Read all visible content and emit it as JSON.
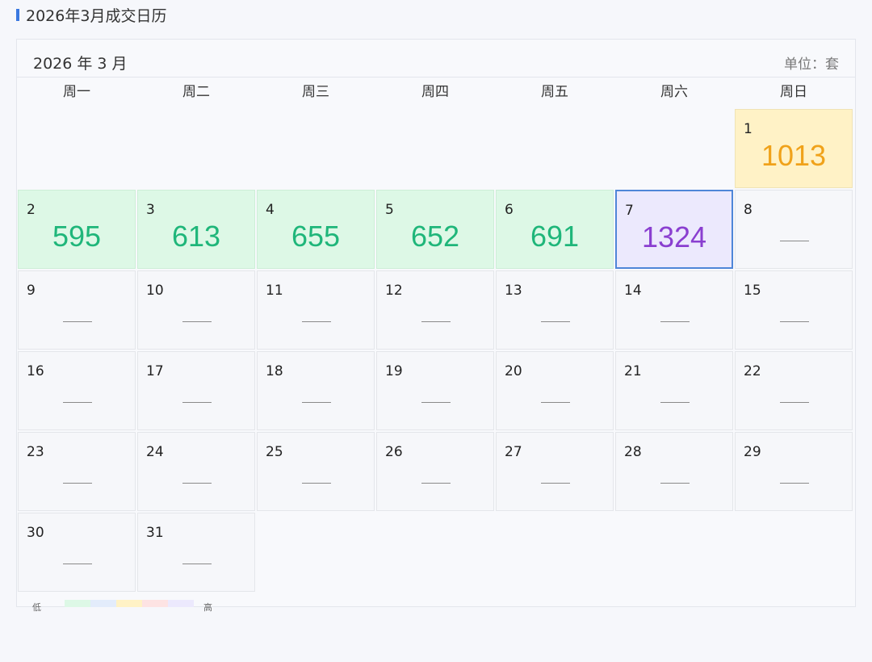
{
  "title": "2026年3月成交日历",
  "calendar": {
    "month_label": "2026 年 3 月",
    "unit_label": "单位：套",
    "weekdays": [
      "周一",
      "周二",
      "周三",
      "周四",
      "周五",
      "周六",
      "周日"
    ],
    "days": [
      {
        "day": "1",
        "value": "1013",
        "level": "yellow"
      },
      {
        "day": "2",
        "value": "595",
        "level": "green"
      },
      {
        "day": "3",
        "value": "613",
        "level": "green"
      },
      {
        "day": "4",
        "value": "655",
        "level": "green"
      },
      {
        "day": "5",
        "value": "652",
        "level": "green"
      },
      {
        "day": "6",
        "value": "691",
        "level": "green"
      },
      {
        "day": "7",
        "value": "1324",
        "level": "purple",
        "selected": true
      },
      {
        "day": "8",
        "value": null
      },
      {
        "day": "9",
        "value": null
      },
      {
        "day": "10",
        "value": null
      },
      {
        "day": "11",
        "value": null
      },
      {
        "day": "12",
        "value": null
      },
      {
        "day": "13",
        "value": null
      },
      {
        "day": "14",
        "value": null
      },
      {
        "day": "15",
        "value": null
      },
      {
        "day": "16",
        "value": null
      },
      {
        "day": "17",
        "value": null
      },
      {
        "day": "18",
        "value": null
      },
      {
        "day": "19",
        "value": null
      },
      {
        "day": "20",
        "value": null
      },
      {
        "day": "21",
        "value": null
      },
      {
        "day": "22",
        "value": null
      },
      {
        "day": "23",
        "value": null
      },
      {
        "day": "24",
        "value": null
      },
      {
        "day": "25",
        "value": null
      },
      {
        "day": "26",
        "value": null
      },
      {
        "day": "27",
        "value": null
      },
      {
        "day": "28",
        "value": null
      },
      {
        "day": "29",
        "value": null
      },
      {
        "day": "30",
        "value": null
      },
      {
        "day": "31",
        "value": null
      }
    ]
  },
  "legend": {
    "low_label": "低",
    "high_label": "高",
    "colors": [
      "#ddf8e6",
      "#e3ecfb",
      "#fff2c6",
      "#fde3e3",
      "#ece9fd"
    ]
  },
  "colors": {
    "accent": "#3a78e0",
    "green": "#1fb67a",
    "yellow": "#f0a21a",
    "purple": "#8a3fd0",
    "selected_border": "#4f86d8"
  }
}
